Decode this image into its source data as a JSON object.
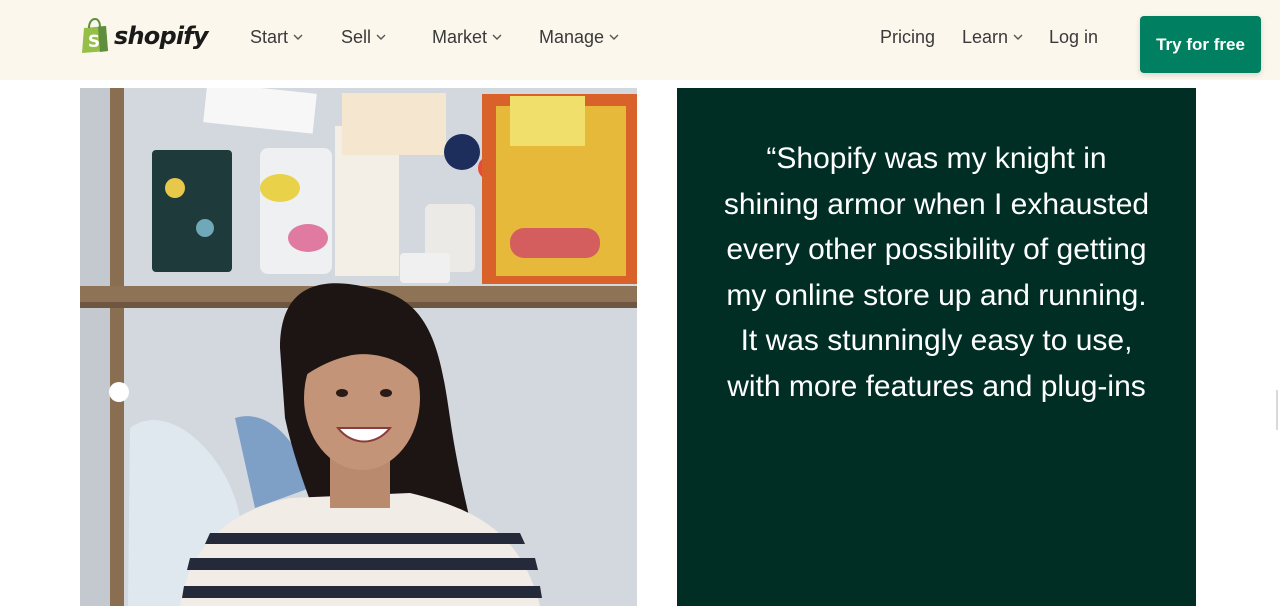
{
  "header": {
    "logo_text": "shopify",
    "nav_left": [
      {
        "label": "Start"
      },
      {
        "label": "Sell"
      },
      {
        "label": "Market"
      },
      {
        "label": "Manage"
      }
    ],
    "nav_right": {
      "pricing": "Pricing",
      "learn": "Learn",
      "login": "Log in"
    },
    "cta_label": "Try for free"
  },
  "colors": {
    "header_bg": "#fbf7ed",
    "brand_green": "#008060",
    "quote_bg": "#002e25",
    "logo_bag": "#95bf47"
  },
  "testimonial": {
    "quote": "“Shopify was my knight in shining armor when I exhausted every other possibility of getting my online store up and running. It was stunningly easy to use, with more features and plug-ins"
  },
  "icons": {
    "logo": "shopping-bag-icon",
    "dropdown": "chevron-down-icon"
  }
}
